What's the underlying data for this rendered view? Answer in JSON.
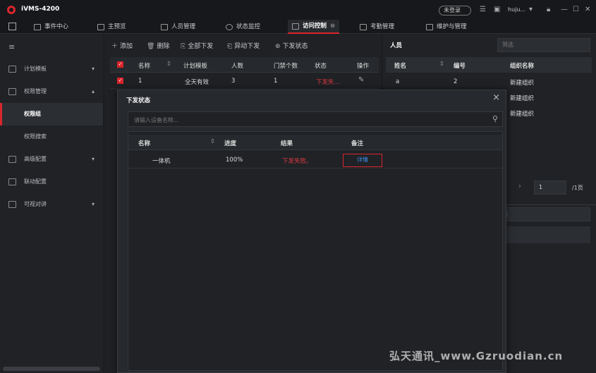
{
  "app": {
    "title": "iVMS-4200",
    "login_status": "未登录",
    "user": "huju..."
  },
  "tabs": [
    {
      "label": "事件中心"
    },
    {
      "label": "主预览"
    },
    {
      "label": "人员管理"
    },
    {
      "label": "状态监控"
    },
    {
      "label": "访问控制"
    },
    {
      "label": "考勤管理"
    },
    {
      "label": "维护与管理"
    }
  ],
  "sidebar": {
    "items": [
      {
        "label": "计划模板",
        "chevron": "▾"
      },
      {
        "label": "权限管理",
        "chevron": "▴"
      },
      {
        "label": "权限组"
      },
      {
        "label": "权限搜索"
      },
      {
        "label": "高级配置",
        "chevron": "▾"
      },
      {
        "label": "联动配置"
      },
      {
        "label": "可视对讲",
        "chevron": "▾"
      }
    ]
  },
  "toolbar": {
    "add": "添加",
    "delete": "删除",
    "apply_all": "全部下发",
    "apply_changes": "异动下发",
    "apply_status": "下发状态"
  },
  "table": {
    "headers": [
      "名称",
      "计划模板",
      "人数",
      "门禁个数",
      "状态",
      "操作"
    ],
    "rows": [
      {
        "name": "1",
        "template": "全天有效",
        "persons": "3",
        "doors": "1",
        "status": "下发失..."
      }
    ]
  },
  "right_panel": {
    "title": "人员",
    "filter_placeholder": "筛选",
    "headers": [
      "姓名",
      "编号",
      "组织名称"
    ],
    "rows": [
      {
        "name": "a",
        "id": "2",
        "org": "新建组织"
      },
      {
        "name": "",
        "id": "",
        "org": "新建组织"
      },
      {
        "name": "",
        "id": "",
        "org": "新建组织"
      }
    ],
    "page_input": "1",
    "page_total": "/1页",
    "filter2_placeholder": "选"
  },
  "modal": {
    "title": "下发状态",
    "search_placeholder": "请输入设备名称...",
    "headers": [
      "名称",
      "进度",
      "结果",
      "备注"
    ],
    "rows": [
      {
        "name": "一体机",
        "progress": "100%",
        "result": "下发失败。",
        "remark": "详情"
      }
    ]
  },
  "watermark": "弘天通讯_www.Gzruodian.cn",
  "colors": {
    "accent": "#d9262c",
    "link": "#3f8ee8",
    "background": "#1b1d21"
  }
}
